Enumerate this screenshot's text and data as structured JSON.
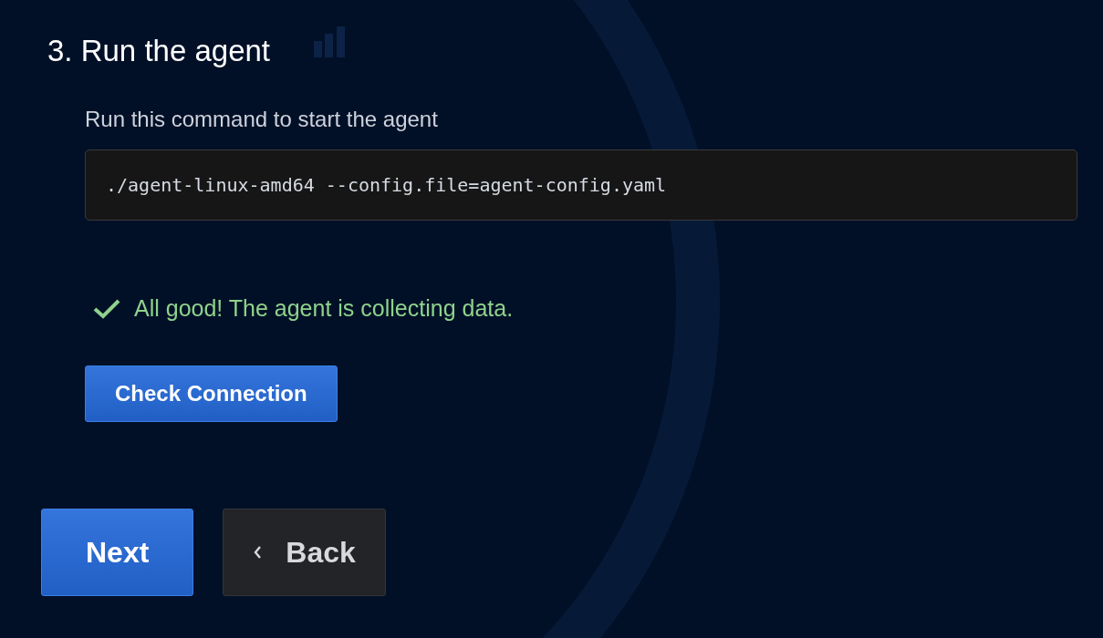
{
  "step": {
    "title": "3. Run the agent"
  },
  "instruction": "Run this command to start the agent",
  "command": "./agent-linux-amd64 --config.file=agent-config.yaml",
  "status": {
    "kind": "success",
    "text": "All good! The agent is collecting data."
  },
  "check_button": {
    "label": "Check Connection"
  },
  "nav_buttons": [
    {
      "kind": "primary",
      "label": "Next"
    },
    {
      "kind": "back",
      "label": "Back"
    }
  ]
}
